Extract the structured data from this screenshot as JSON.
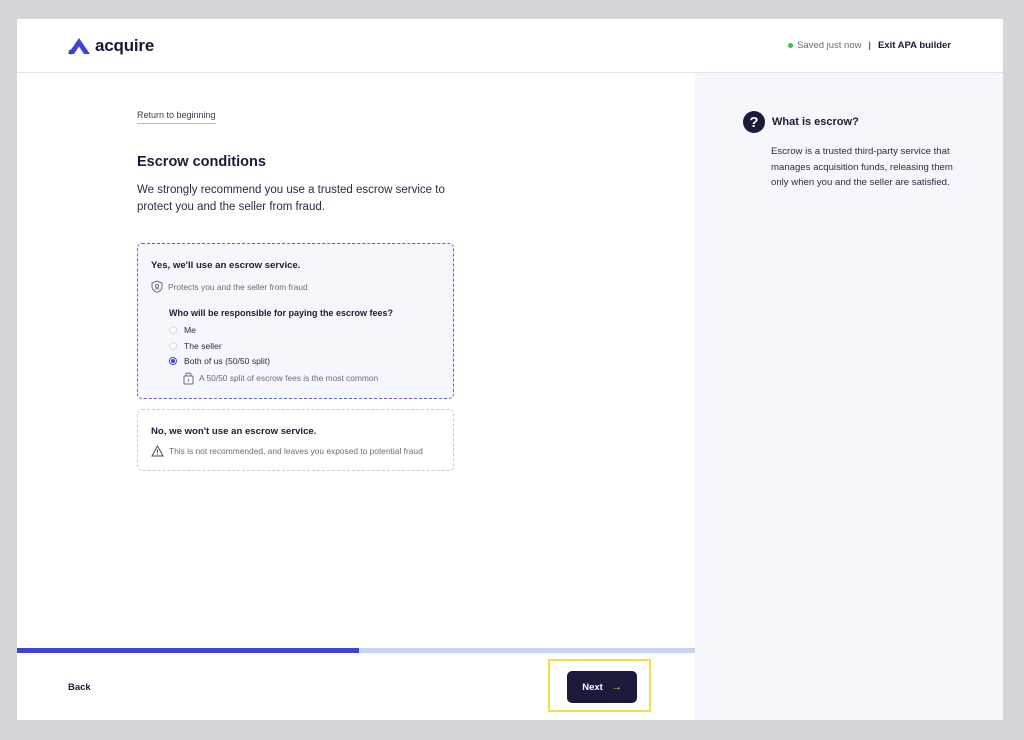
{
  "header": {
    "logo_text": "acquire",
    "save_status": "Saved just now",
    "separator": "|",
    "exit_label": "Exit APA builder"
  },
  "main": {
    "return_link": "Return to beginning",
    "title": "Escrow conditions",
    "intro": "We strongly recommend you use a trusted escrow service to protect you and the seller from fraud.",
    "options": [
      {
        "title": "Yes, we'll use an escrow service.",
        "note": "Protects you and the seller from fraud",
        "question": "Who will be responsible for paying the escrow fees?",
        "choices": [
          "Me",
          "The seller",
          "Both of us (50/50 split)"
        ],
        "selected": "Both of us (50/50 split)",
        "tip": "A 50/50 split of escrow fees is the most common"
      },
      {
        "title": "No, we won't use an escrow service.",
        "note": "This is not recommended, and leaves you exposed to potential fraud"
      }
    ]
  },
  "sidebar": {
    "icon": "?",
    "title": "What is escrow?",
    "body": "Escrow is a trusted third-party service that manages acquisition funds, releasing them only when you and the seller are satisfied."
  },
  "progress": {
    "fraction": 0.505
  },
  "footer": {
    "back_label": "Back",
    "next_label": "Next",
    "next_arrow": "→"
  },
  "colors": {
    "navy": "#1c1a3a",
    "accent": "#3f43d9",
    "status_green": "#3cc13b",
    "highlight": "#f2dd4e",
    "panel_bg": "#f6f7fc"
  }
}
